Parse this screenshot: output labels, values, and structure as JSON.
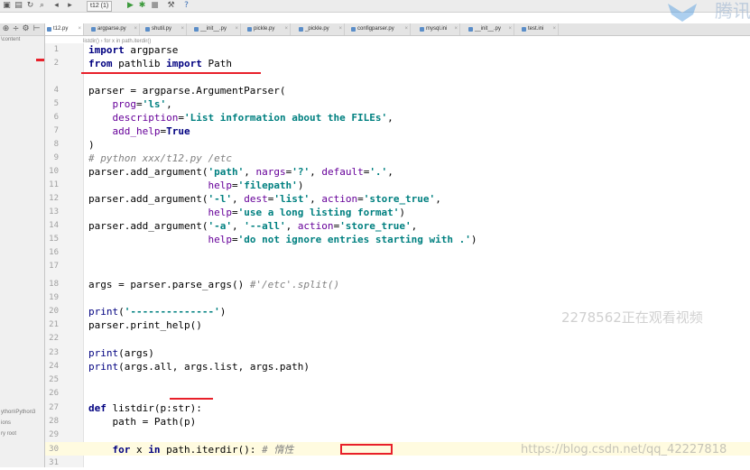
{
  "toolbar": {
    "run_config": "t12 (1)",
    "icons": [
      "open-icon",
      "save-icon",
      "refresh-icon",
      "back-icon",
      "forward-icon",
      "run-icon",
      "debug-icon",
      "stop-icon",
      "build-icon",
      "help-icon"
    ]
  },
  "logo": {
    "text": "腾讯"
  },
  "tabs": [
    {
      "label": "t12.py",
      "active": true
    },
    {
      "label": "argparse.py",
      "active": false
    },
    {
      "label": "shutil.py",
      "active": false
    },
    {
      "label": "__init__.py",
      "active": false
    },
    {
      "label": "pickle.py",
      "active": false
    },
    {
      "label": "_pickle.py",
      "active": false
    },
    {
      "label": "configparser.py",
      "active": false
    },
    {
      "label": "mysql.ini",
      "active": false
    },
    {
      "label": "__init__.py",
      "active": false
    },
    {
      "label": "test.ini",
      "active": false
    }
  ],
  "sidebar": {
    "top_label": "\\content",
    "item1": "ython\\Python3",
    "item2": "ions",
    "item3": "ry root"
  },
  "breadcrumb": {
    "text": "listdir()  ›  for x in path.iterdir()"
  },
  "code": {
    "n1": "1",
    "n2": "2",
    "n4": "4",
    "n5": "5",
    "n6": "6",
    "n7": "7",
    "n8": "8",
    "n9": "9",
    "n10": "10",
    "n11": "11",
    "n12": "12",
    "n13": "13",
    "n14": "14",
    "n15": "15",
    "n16": "16",
    "n17": "17",
    "n18": "18",
    "n19": "19",
    "n20": "20",
    "n21": "21",
    "n22": "22",
    "n23": "23",
    "n24": "24",
    "n25": "25",
    "n26": "26",
    "n27": "27",
    "n28": "28",
    "n29": "29",
    "n30": "30",
    "n31": "31"
  },
  "overlay": {
    "watermark": "2278562正在观看视频",
    "url": "https://blog.csdn.net/qq_42227818"
  },
  "colors": {
    "keyword": "#000080",
    "string": "#008080",
    "comment": "#808080",
    "param": "#660099",
    "annotation": "#e8202a"
  }
}
